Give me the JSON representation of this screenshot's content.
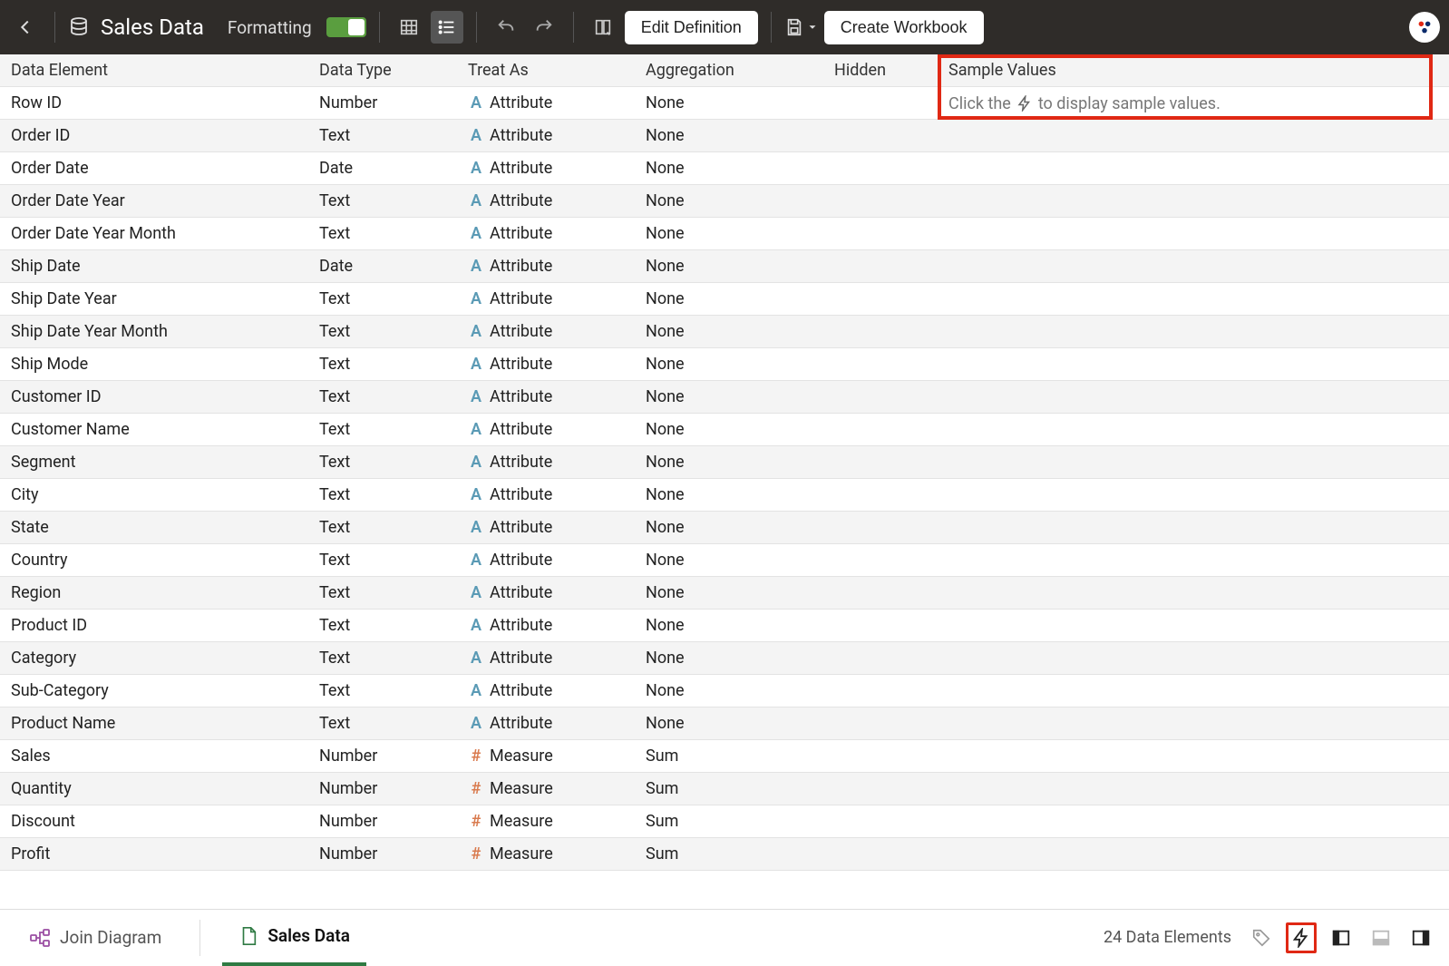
{
  "toolbar": {
    "title": "Sales Data",
    "formatting_label": "Formatting",
    "edit_definition_label": "Edit Definition",
    "create_workbook_label": "Create Workbook"
  },
  "columns": {
    "element": "Data Element",
    "type": "Data Type",
    "treat_as": "Treat As",
    "aggregation": "Aggregation",
    "hidden": "Hidden",
    "sample": "Sample Values"
  },
  "sample_hint_prefix": "Click the",
  "sample_hint_suffix": "to display sample values.",
  "rows": [
    {
      "element": "Row ID",
      "type": "Number",
      "treat": "Attribute",
      "agg": "None",
      "kind": "attr"
    },
    {
      "element": "Order ID",
      "type": "Text",
      "treat": "Attribute",
      "agg": "None",
      "kind": "attr"
    },
    {
      "element": "Order Date",
      "type": "Date",
      "treat": "Attribute",
      "agg": "None",
      "kind": "attr"
    },
    {
      "element": "Order Date Year",
      "type": "Text",
      "treat": "Attribute",
      "agg": "None",
      "kind": "attr"
    },
    {
      "element": "Order Date Year Month",
      "type": "Text",
      "treat": "Attribute",
      "agg": "None",
      "kind": "attr"
    },
    {
      "element": "Ship Date",
      "type": "Date",
      "treat": "Attribute",
      "agg": "None",
      "kind": "attr"
    },
    {
      "element": "Ship Date Year",
      "type": "Text",
      "treat": "Attribute",
      "agg": "None",
      "kind": "attr"
    },
    {
      "element": "Ship Date Year Month",
      "type": "Text",
      "treat": "Attribute",
      "agg": "None",
      "kind": "attr"
    },
    {
      "element": "Ship Mode",
      "type": "Text",
      "treat": "Attribute",
      "agg": "None",
      "kind": "attr"
    },
    {
      "element": "Customer ID",
      "type": "Text",
      "treat": "Attribute",
      "agg": "None",
      "kind": "attr"
    },
    {
      "element": "Customer Name",
      "type": "Text",
      "treat": "Attribute",
      "agg": "None",
      "kind": "attr"
    },
    {
      "element": "Segment",
      "type": "Text",
      "treat": "Attribute",
      "agg": "None",
      "kind": "attr"
    },
    {
      "element": "City",
      "type": "Text",
      "treat": "Attribute",
      "agg": "None",
      "kind": "attr"
    },
    {
      "element": "State",
      "type": "Text",
      "treat": "Attribute",
      "agg": "None",
      "kind": "attr"
    },
    {
      "element": "Country",
      "type": "Text",
      "treat": "Attribute",
      "agg": "None",
      "kind": "attr"
    },
    {
      "element": "Region",
      "type": "Text",
      "treat": "Attribute",
      "agg": "None",
      "kind": "attr"
    },
    {
      "element": "Product ID",
      "type": "Text",
      "treat": "Attribute",
      "agg": "None",
      "kind": "attr"
    },
    {
      "element": "Category",
      "type": "Text",
      "treat": "Attribute",
      "agg": "None",
      "kind": "attr"
    },
    {
      "element": "Sub-Category",
      "type": "Text",
      "treat": "Attribute",
      "agg": "None",
      "kind": "attr"
    },
    {
      "element": "Product Name",
      "type": "Text",
      "treat": "Attribute",
      "agg": "None",
      "kind": "attr"
    },
    {
      "element": "Sales",
      "type": "Number",
      "treat": "Measure",
      "agg": "Sum",
      "kind": "meas"
    },
    {
      "element": "Quantity",
      "type": "Number",
      "treat": "Measure",
      "agg": "Sum",
      "kind": "meas"
    },
    {
      "element": "Discount",
      "type": "Number",
      "treat": "Measure",
      "agg": "Sum",
      "kind": "meas"
    },
    {
      "element": "Profit",
      "type": "Number",
      "treat": "Measure",
      "agg": "Sum",
      "kind": "meas"
    }
  ],
  "footer": {
    "join_diagram_label": "Join Diagram",
    "active_tab_label": "Sales Data",
    "status": "24 Data Elements"
  }
}
